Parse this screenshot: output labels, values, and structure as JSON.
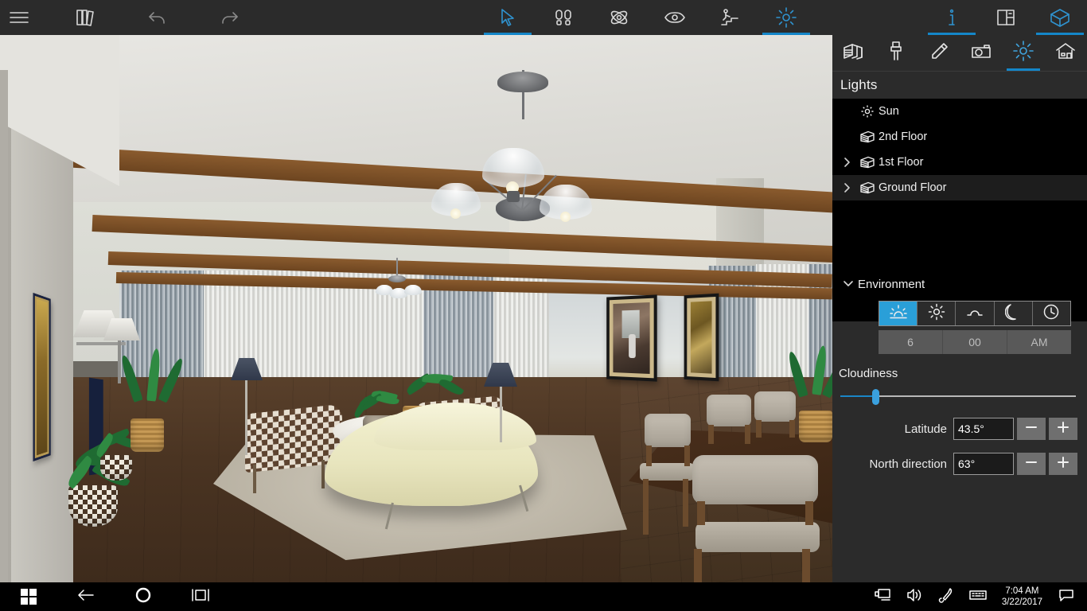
{
  "app": {
    "toolbar_left": [
      {
        "name": "hamburger-menu",
        "icon": "menu-icon",
        "label": "Menu"
      },
      {
        "name": "catalog",
        "icon": "books-icon",
        "label": "Catalog"
      },
      {
        "name": "undo",
        "icon": "undo-icon",
        "label": "Undo"
      },
      {
        "name": "redo",
        "icon": "redo-icon",
        "label": "Redo"
      }
    ],
    "toolbar_center": [
      {
        "name": "select-tool",
        "icon": "cursor-icon",
        "label": "Select",
        "active": true
      },
      {
        "name": "walk-tool",
        "icon": "footprints-icon",
        "label": "Walk",
        "active": false
      },
      {
        "name": "orbit-tool",
        "icon": "orbit-icon",
        "label": "Orbit",
        "active": false
      },
      {
        "name": "view-tool",
        "icon": "eye-icon",
        "label": "View",
        "active": false
      },
      {
        "name": "stairs-tool",
        "icon": "person-stairs-icon",
        "label": "Level",
        "active": false
      },
      {
        "name": "light-tool",
        "icon": "sun-icon",
        "label": "Lighting",
        "active": true
      }
    ],
    "toolbar_right": [
      {
        "name": "info",
        "icon": "info-icon",
        "label": "Info",
        "active": true
      },
      {
        "name": "floorplan-view",
        "icon": "floorplan-icon",
        "label": "Floor plan",
        "active": false
      },
      {
        "name": "3d-view",
        "icon": "cube-house-icon",
        "label": "3D view",
        "active": true
      }
    ]
  },
  "panel": {
    "tabs": [
      {
        "name": "tab-build",
        "icon": "wall-icon",
        "label": "Build",
        "active": false
      },
      {
        "name": "tab-paint",
        "icon": "brush-icon",
        "label": "Materials",
        "active": false
      },
      {
        "name": "tab-draw",
        "icon": "pencil-icon",
        "label": "Draw",
        "active": false
      },
      {
        "name": "tab-camera",
        "icon": "camera-icon",
        "label": "Camera",
        "active": false
      },
      {
        "name": "tab-lights",
        "icon": "sun-icon",
        "label": "Lights",
        "active": true
      },
      {
        "name": "tab-project",
        "icon": "house-icon",
        "label": "Project",
        "active": false
      }
    ],
    "title": "Lights",
    "tree": [
      {
        "label": "Sun",
        "icon": "sun-small-icon",
        "expandable": false,
        "selected": false,
        "indent": 1
      },
      {
        "label": "2nd Floor",
        "icon": "floor-slab-icon",
        "expandable": false,
        "selected": false,
        "indent": 1
      },
      {
        "label": "1st Floor",
        "icon": "floor-slab-icon",
        "expandable": true,
        "selected": false,
        "indent": 0
      },
      {
        "label": "Ground Floor",
        "icon": "floor-slab-icon",
        "expandable": true,
        "selected": true,
        "indent": 0
      }
    ],
    "environment": {
      "section_label": "Environment",
      "expanded": true,
      "presets": [
        {
          "name": "preset-sunrise",
          "icon": "sunrise-icon",
          "label": "Sunrise",
          "active": true
        },
        {
          "name": "preset-noon",
          "icon": "sun-icon",
          "label": "Noon",
          "active": false
        },
        {
          "name": "preset-sunset",
          "icon": "sunset-icon",
          "label": "Sunset",
          "active": false
        },
        {
          "name": "preset-night",
          "icon": "moon-icon",
          "label": "Night",
          "active": false
        },
        {
          "name": "preset-custom",
          "icon": "clock-icon",
          "label": "Custom time",
          "active": false
        }
      ],
      "time": {
        "hour": "6",
        "minute": "00",
        "meridiem": "AM"
      },
      "cloudiness": {
        "label": "Cloudiness",
        "value": 15
      },
      "latitude": {
        "label": "Latitude",
        "value": "43.5°",
        "minus": "−",
        "plus": "+"
      },
      "north_direction": {
        "label": "North direction",
        "value": "63°",
        "minus": "−",
        "plus": "+"
      }
    }
  },
  "viewport": {
    "scene_name": "living-room-3d-render",
    "expander": "chevron-right-icon",
    "objects": [
      "ceiling-beams",
      "chandelier",
      "small-chandelier",
      "sheer-curtains",
      "picture-window",
      "cream-curved-sofa",
      "round-coffee-table",
      "checkered-armchairs",
      "floor-lamps",
      "potted-plants",
      "framed-wall-art",
      "wall-sconce",
      "dining-table",
      "dining-chairs",
      "area-rug",
      "hardwood-floor",
      "tile-floor"
    ]
  },
  "taskbar": {
    "left": [
      {
        "name": "start-button",
        "icon": "windows-logo-icon"
      },
      {
        "name": "back-button",
        "icon": "arrow-left-icon"
      },
      {
        "name": "cortana-button",
        "icon": "circle-icon"
      },
      {
        "name": "task-view-button",
        "icon": "task-view-icon"
      }
    ],
    "right": [
      {
        "name": "display-tray-icon",
        "icon": "monitor-icon"
      },
      {
        "name": "volume-tray-icon",
        "icon": "speaker-icon"
      },
      {
        "name": "pen-tray-icon",
        "icon": "pen-icon"
      },
      {
        "name": "keyboard-tray-icon",
        "icon": "keyboard-icon"
      }
    ],
    "clock": {
      "time": "7:04 AM",
      "date": "3/22/2017"
    },
    "notification": {
      "name": "action-center-button",
      "icon": "speech-bubble-icon"
    }
  },
  "colors": {
    "accent": "#1486c8",
    "accent_light": "#2a9fd8",
    "panel_bg": "#2b2b2b",
    "tree_bg": "#000000",
    "toolbar_bg": "#2b2b2b"
  }
}
